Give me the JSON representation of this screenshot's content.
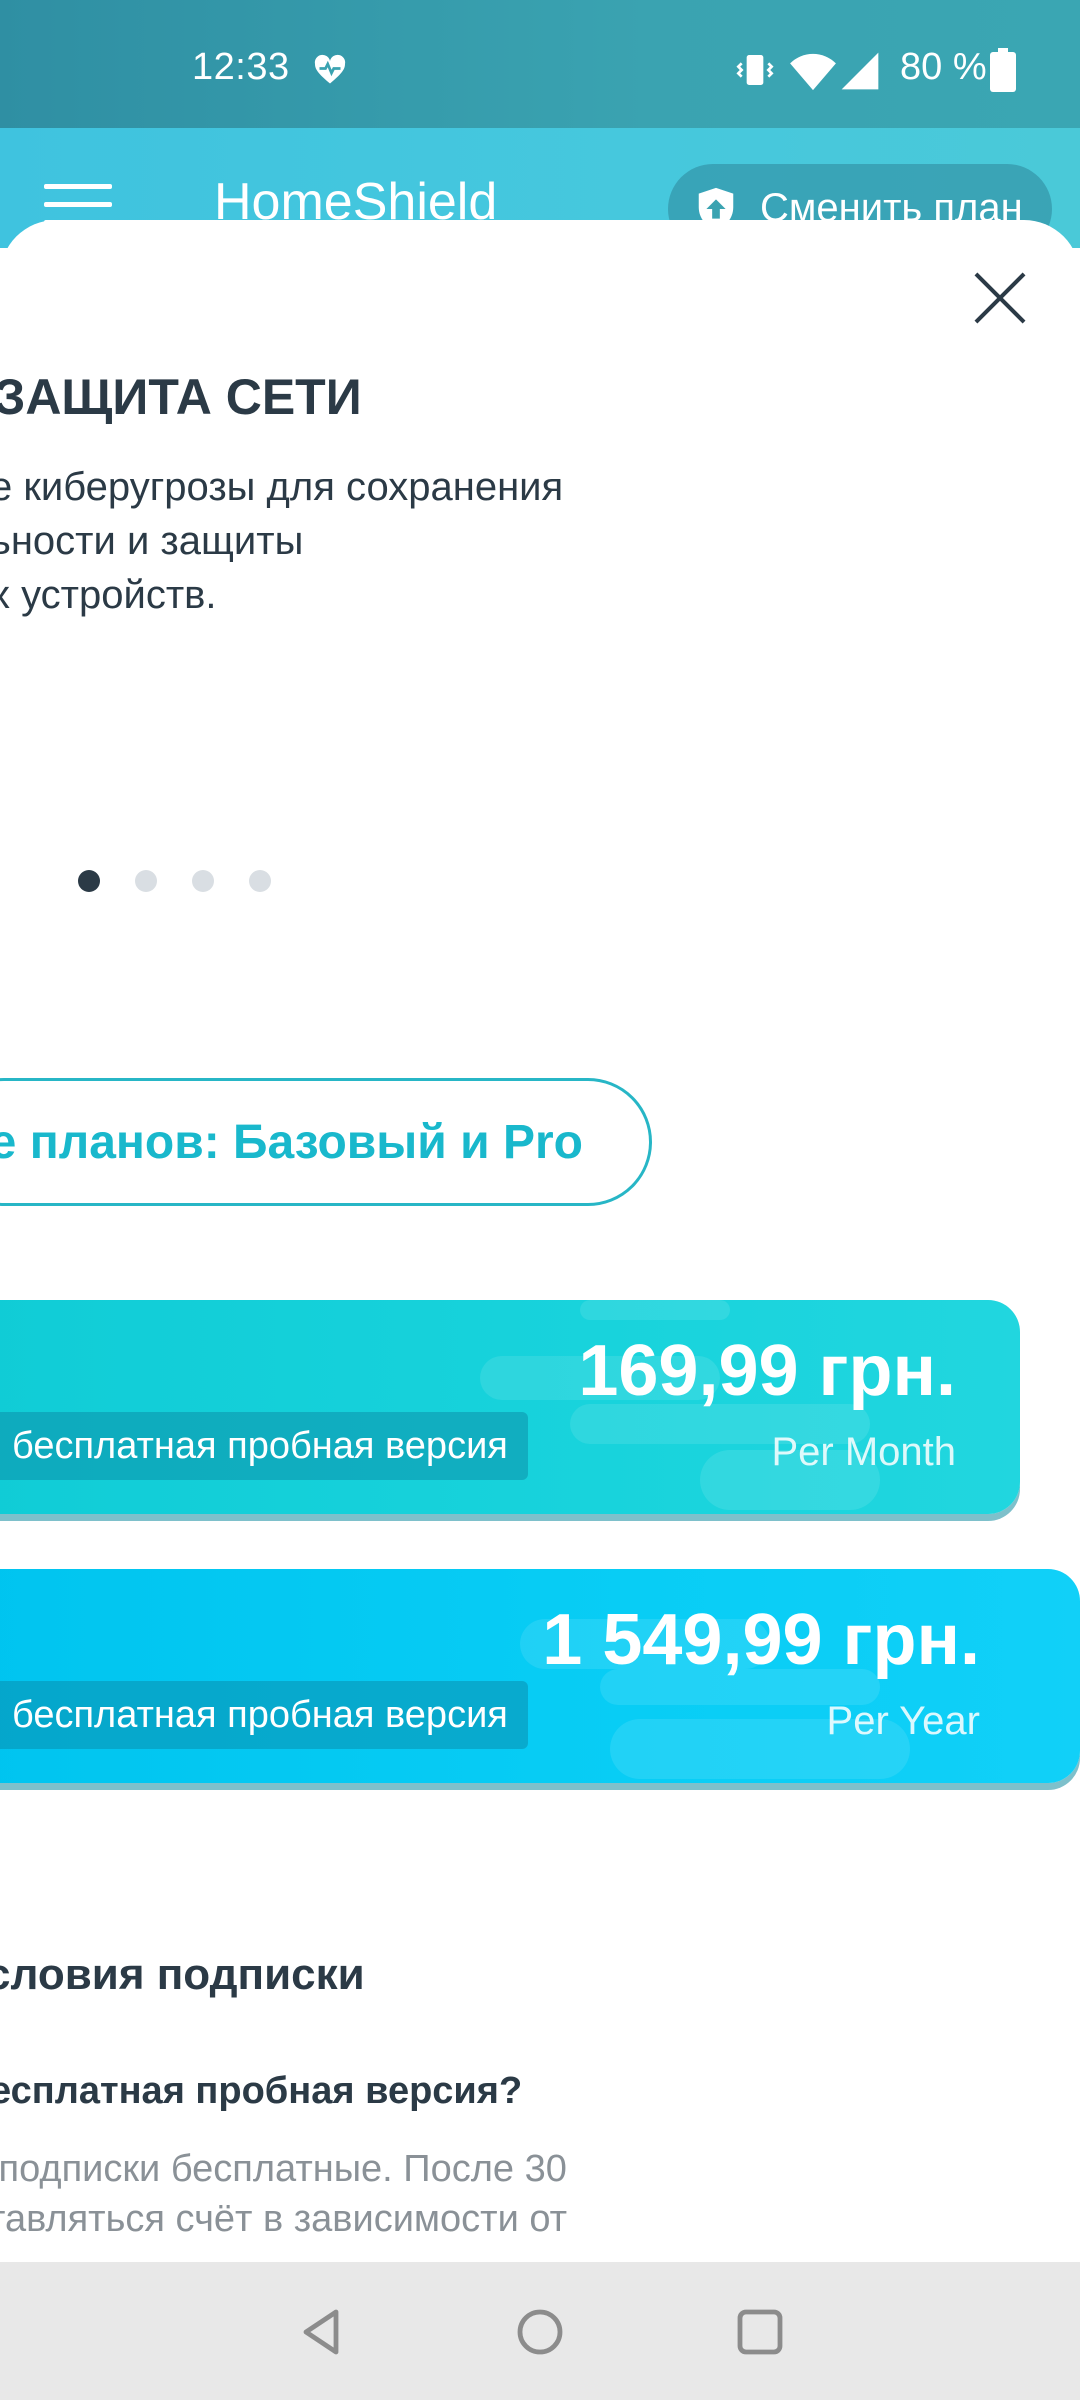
{
  "status_bar": {
    "time": "12:33",
    "battery": "80 %",
    "icons": [
      "heart-health-icon",
      "vibrate-icon",
      "wifi-icon",
      "cell-signal-icon",
      "battery-icon"
    ]
  },
  "app_bar": {
    "title": "HomeShield",
    "change_plan_label": "Сменить план"
  },
  "slide": {
    "title": "ЗАЩИТА СЕТИ",
    "description": "е киберугрозы для сохранения\nьности и защиты\nх устройств.",
    "page_count": 4,
    "active_page": 1
  },
  "compare_button": "е планов: Базовый и Pro",
  "plans": [
    {
      "price": "169,99 грн.",
      "period": "Per Month",
      "trial": "бесплатная пробная версия"
    },
    {
      "price": "1 549,99 грн.",
      "period": "Per Year",
      "trial": "бесплатная пробная версия"
    }
  ],
  "terms": {
    "title": "словия подписки",
    "question": "есплатная пробная версия?",
    "answer": " подписки бесплатные. После 30\nтавляться счёт в зависимости от\nи плана"
  },
  "colors": {
    "status_bar": "#3aa3b1",
    "app_bar": "#46c8dd",
    "accent": "#19b8cc",
    "month_card": "#18d3dc",
    "year_card": "#08cdf5",
    "text_dark": "#2b3a46",
    "text_muted": "#8a9197"
  }
}
